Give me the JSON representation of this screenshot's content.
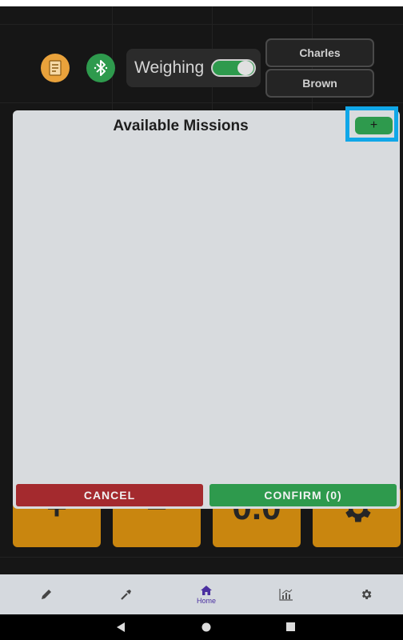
{
  "header": {
    "weighing_label": "Weighing",
    "weighing_on": true,
    "first_name": "Charles",
    "last_name": "Brown",
    "print_icon": "receipt-icon",
    "bluetooth_icon": "bluetooth-icon"
  },
  "background_tiles": [
    {
      "glyph": "+",
      "name": "plus"
    },
    {
      "glyph": "−",
      "name": "minus"
    },
    {
      "glyph": "0.0",
      "name": "value"
    },
    {
      "glyph": "gear",
      "name": "settings"
    }
  ],
  "modal": {
    "title": "Available Missions",
    "add_label": "+",
    "cancel_label": "CANCEL",
    "confirm_label": "CONFIRM (0)"
  },
  "nav": {
    "items": [
      {
        "icon": "pencil-icon",
        "label": ""
      },
      {
        "icon": "tool-icon",
        "label": ""
      },
      {
        "icon": "home-icon",
        "label": "Home"
      },
      {
        "icon": "chart-icon",
        "label": ""
      },
      {
        "icon": "gear-icon",
        "label": ""
      }
    ],
    "active_index": 2
  },
  "colors": {
    "accent_green": "#2e9a4d",
    "cancel_red": "#a42a2e",
    "tile_orange": "#c9860f",
    "highlight_blue": "#10a7e8",
    "nav_active": "#4a2fa0"
  }
}
